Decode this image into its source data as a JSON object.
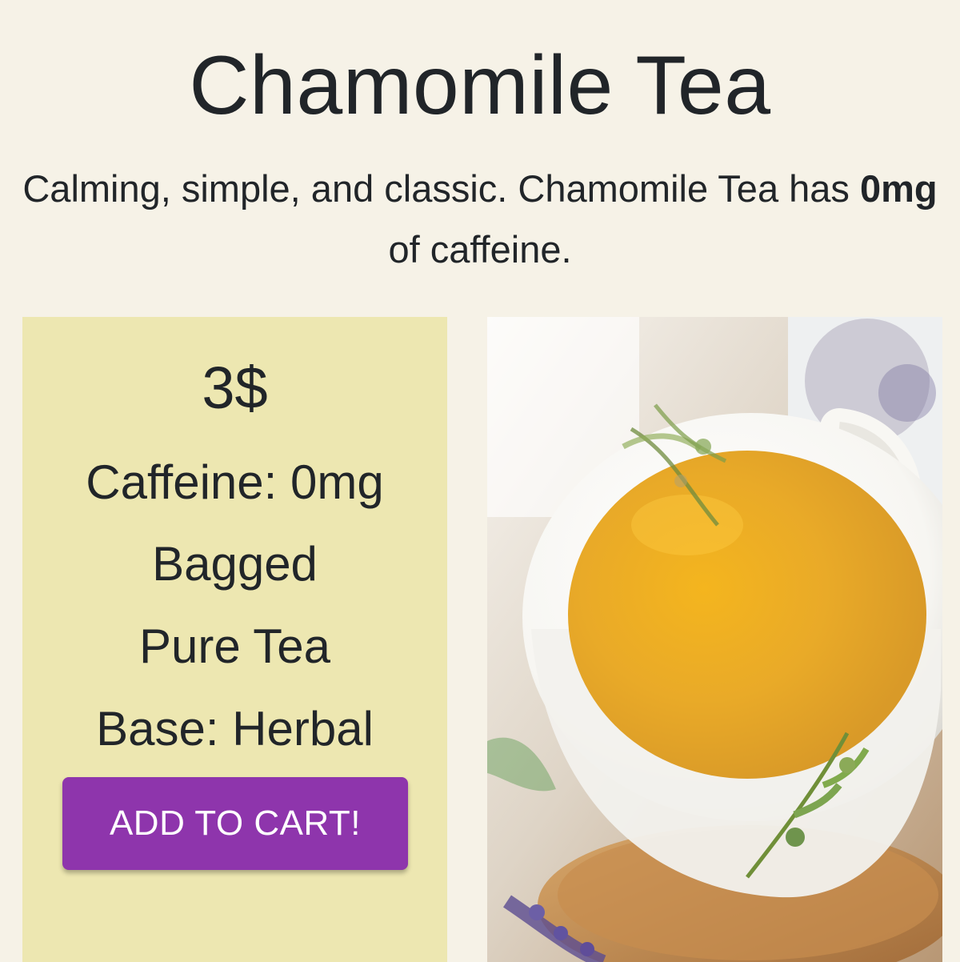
{
  "product": {
    "title": "Chamomile Tea",
    "description_prefix": "Calming, simple, and classic. Chamomile Tea has ",
    "description_caffeine": "0mg",
    "description_suffix": " of caffeine.",
    "price": "3$",
    "caffeine": "Caffeine: 0mg",
    "format": "Bagged",
    "type": "Pure Tea",
    "base": "Base: Herbal",
    "cart_button_label": "ADD TO CART!",
    "image_icon": "tea-cup-image"
  },
  "colors": {
    "page_background": "#f6f2e7",
    "panel_background": "#ede7b1",
    "button_background": "#8e35ac",
    "button_text": "#ffffff",
    "text": "#212529",
    "tea": "#f0b625"
  }
}
